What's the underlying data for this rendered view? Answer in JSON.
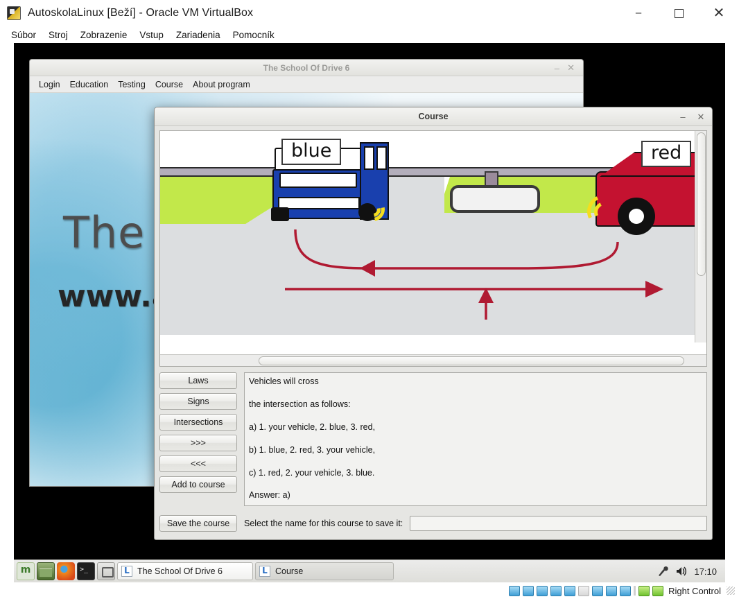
{
  "vbox": {
    "title": "AutoskolaLinux [Beží] - Oracle VM VirtualBox",
    "icon": "virtualbox-icon",
    "menu": [
      "Súbor",
      "Stroj",
      "Zobrazenie",
      "Vstup",
      "Zariadenia",
      "Pomocník"
    ],
    "controls": {
      "minimize": "–",
      "maximize": "□",
      "close": "✕"
    },
    "statusbar": {
      "host_key": "Right Control",
      "icons": [
        "hard-disk-icon",
        "optical-drive-icon",
        "audio-icon",
        "network-icon",
        "usb-icon",
        "shared-folder-icon",
        "display-icon",
        "recording-icon",
        "virtualization-icon",
        "mouse-integration-icon",
        "host-key-icon"
      ]
    }
  },
  "app_window": {
    "title": "The School Of Drive 6",
    "menu": [
      "Login",
      "Education",
      "Testing",
      "Course",
      "About program"
    ],
    "controls": {
      "minimize": "–",
      "close": "✕"
    },
    "wallpaper": {
      "line1": "The",
      "line2": "www.a"
    }
  },
  "course_dialog": {
    "title": "Course",
    "controls": {
      "minimize": "–",
      "close": "✕"
    },
    "illustration": {
      "label_left": "blue",
      "label_right": "red",
      "description": "intersection-illustration-blue-truck-red-car"
    },
    "buttons": [
      {
        "name": "laws-button",
        "label": "Laws"
      },
      {
        "name": "signs-button",
        "label": "Signs"
      },
      {
        "name": "intersections-button",
        "label": "Intersections"
      },
      {
        "name": "next-button",
        "label": ">>>"
      },
      {
        "name": "previous-button",
        "label": "<<<"
      },
      {
        "name": "add-to-course-button",
        "label": "Add to course"
      }
    ],
    "question_text": [
      "Vehicles will cross",
      "the intersection as follows:",
      "a) 1. your vehicle, 2. blue, 3. red,",
      "b) 1. blue, 2. red, 3. your vehicle,",
      "c) 1. red, 2. your vehicle, 3. blue.",
      "Answer: a)"
    ],
    "save_button_label": "Save the course",
    "save_prompt": "Select the name for this course to save it:",
    "course_name_value": "",
    "course_name_placeholder": ""
  },
  "taskbar": {
    "launchers": [
      "mint-menu-icon",
      "file-manager-icon",
      "firefox-icon",
      "terminal-icon",
      "software-manager-icon"
    ],
    "windows": [
      {
        "label": "The School Of Drive 6",
        "active": true
      },
      {
        "label": "Course",
        "active": false
      }
    ],
    "tray": {
      "mic_icon": "microphone-icon",
      "volume_icon": "speaker-icon",
      "clock": "17:10"
    }
  },
  "colors": {
    "truck_blue": "#1940ae",
    "car_red": "#c41230",
    "grass_green": "#c2e84a",
    "road_grey": "#dcdee0",
    "arrow_red": "#b01a32"
  }
}
